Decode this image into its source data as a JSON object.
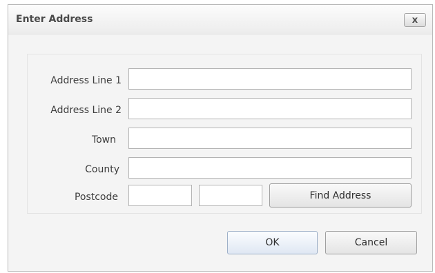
{
  "dialog": {
    "title": "Enter Address",
    "close_glyph": "x"
  },
  "form": {
    "address_line_1": {
      "label": "Address Line 1",
      "value": ""
    },
    "address_line_2": {
      "label": "Address Line 2",
      "value": ""
    },
    "town": {
      "label": "Town",
      "value": ""
    },
    "county": {
      "label": "County",
      "value": ""
    },
    "postcode": {
      "label": "Postcode",
      "part1_value": "",
      "part2_value": ""
    },
    "find_address_label": "Find Address"
  },
  "footer": {
    "ok_label": "OK",
    "cancel_label": "Cancel"
  },
  "icons": {
    "close": "close-icon"
  },
  "colors": {
    "primary_button": "#dfe7f3",
    "dialog_background": "#f4f4f4"
  }
}
